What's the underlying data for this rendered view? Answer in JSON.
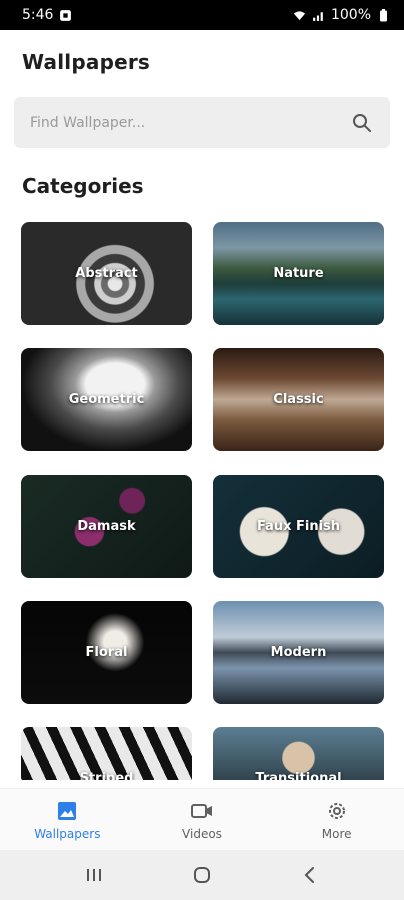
{
  "status_bar": {
    "time": "5:46",
    "battery": "100%"
  },
  "header": {
    "title": "Wallpapers"
  },
  "search": {
    "placeholder": "Find Wallpaper..."
  },
  "section": {
    "title": "Categories"
  },
  "categories": [
    {
      "label": "Abstract"
    },
    {
      "label": "Nature"
    },
    {
      "label": "Geometric"
    },
    {
      "label": "Classic"
    },
    {
      "label": "Damask"
    },
    {
      "label": "Faux Finish"
    },
    {
      "label": "Floral"
    },
    {
      "label": "Modern"
    },
    {
      "label": "Striped"
    },
    {
      "label": "Transitional"
    }
  ],
  "bottom_nav": {
    "items": [
      {
        "label": "Wallpapers",
        "icon": "image-icon",
        "active": true
      },
      {
        "label": "Videos",
        "icon": "video-camera-icon",
        "active": false
      },
      {
        "label": "More",
        "icon": "gear-icon",
        "active": false
      }
    ]
  },
  "colors": {
    "accent": "#2f7fe8",
    "search_bg": "#eeeeee"
  }
}
